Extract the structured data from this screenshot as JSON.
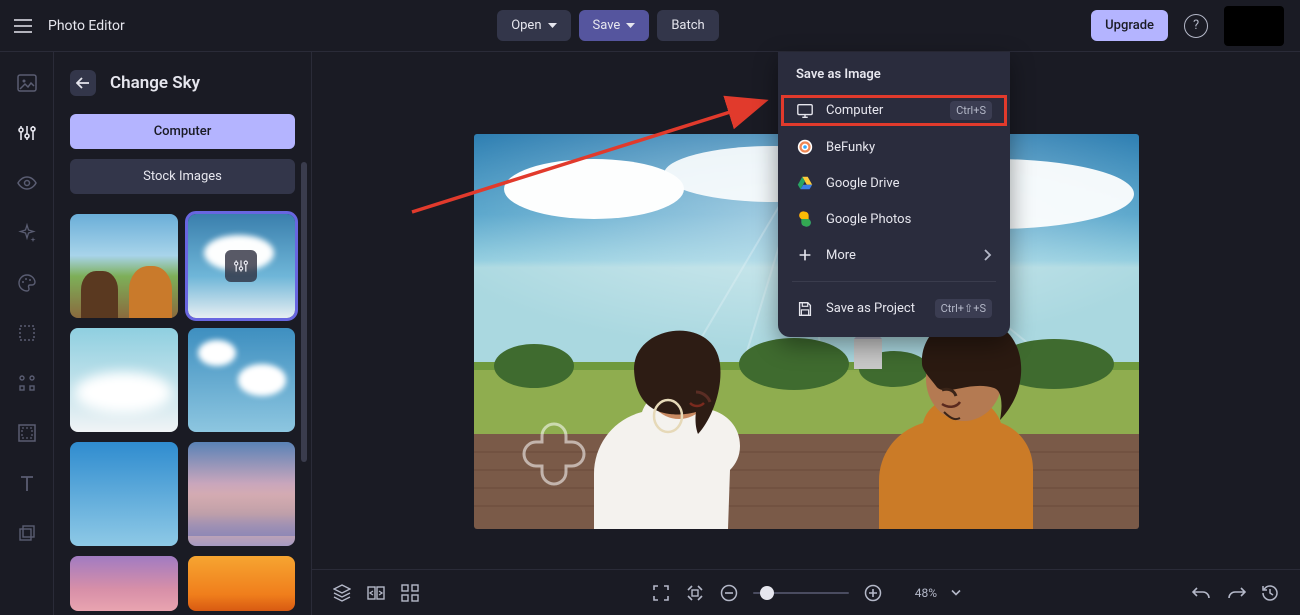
{
  "app": {
    "title": "Photo Editor"
  },
  "toolbar": {
    "open_label": "Open",
    "save_label": "Save",
    "batch_label": "Batch",
    "upgrade_label": "Upgrade"
  },
  "panel": {
    "title": "Change Sky",
    "tabs": {
      "computer": "Computer",
      "stock": "Stock Images"
    }
  },
  "rail": {
    "items": [
      "image",
      "sliders",
      "eye",
      "sparkle",
      "palette",
      "crop",
      "apps",
      "frame",
      "text",
      "layers"
    ]
  },
  "dropdown": {
    "title": "Save as Image",
    "items": [
      {
        "icon": "monitor",
        "label": "Computer",
        "shortcut": "Ctrl+S"
      },
      {
        "icon": "befunky",
        "label": "BeFunky"
      },
      {
        "icon": "gdrive",
        "label": "Google Drive"
      },
      {
        "icon": "gphotos",
        "label": "Google Photos"
      },
      {
        "icon": "plus",
        "label": "More",
        "more": true
      }
    ],
    "project": {
      "icon": "save",
      "label": "Save as Project",
      "shortcut": "Ctrl+⇧+S"
    }
  },
  "bottom": {
    "zoom_value": "48%"
  },
  "colors": {
    "accent": "#7b79f0",
    "highlight": "#e13a2c"
  }
}
